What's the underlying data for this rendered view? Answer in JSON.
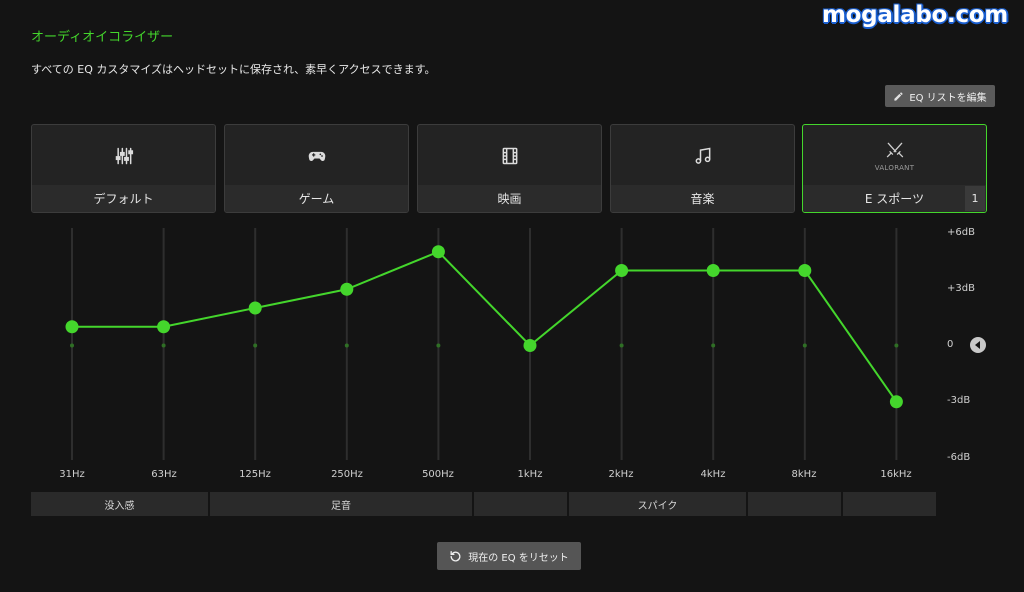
{
  "watermark": "mogalabo.com",
  "header": {
    "title": "オーディオイコライザー",
    "subtitle": "すべての EQ カスタマイズはヘッドセットに保存され、素早くアクセスできます。",
    "edit_label": "EQ リストを編集"
  },
  "presets": [
    {
      "label": "デフォルト",
      "icon": "sliders-icon"
    },
    {
      "label": "ゲーム",
      "icon": "gamepad-icon"
    },
    {
      "label": "映画",
      "icon": "film-icon"
    },
    {
      "label": "音楽",
      "icon": "music-note-icon"
    },
    {
      "label": "E スポーツ",
      "icon": "valorant-icon",
      "sub": "VALORANT",
      "badge": "1",
      "active": true
    }
  ],
  "eq": {
    "db_labels": [
      "+6dB",
      "+3dB",
      "0",
      "-3dB",
      "-6dB"
    ],
    "db_range": [
      -6,
      6
    ],
    "bands": [
      "31Hz",
      "63Hz",
      "125Hz",
      "250Hz",
      "500Hz",
      "1kHz",
      "2kHz",
      "4kHz",
      "8kHz",
      "16kHz"
    ],
    "values": [
      1,
      1,
      2,
      3,
      5,
      0,
      4,
      4,
      4,
      -3
    ],
    "accent": "#44d62c"
  },
  "zones": [
    {
      "label": "没入感"
    },
    {
      "label": "足音"
    },
    {
      "label": ""
    },
    {
      "label": "スパイク"
    },
    {
      "label": ""
    },
    {
      "label": ""
    }
  ],
  "reset_label": "現在の EQ をリセット"
}
